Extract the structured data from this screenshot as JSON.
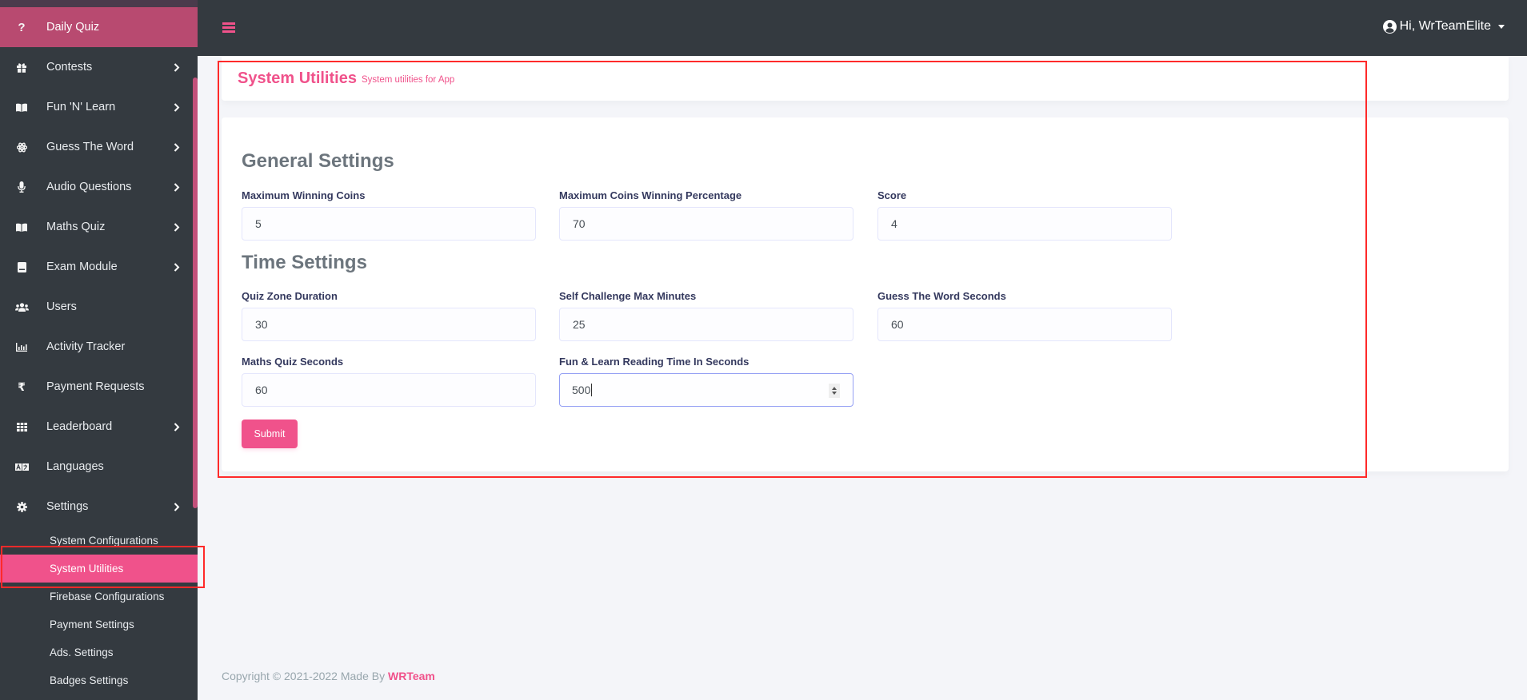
{
  "sidebar": {
    "items": [
      {
        "label": "Daily Quiz",
        "icon": "question-icon",
        "glyph": "?",
        "active": true,
        "has_children": false
      },
      {
        "label": "Contests",
        "icon": "gift-icon",
        "has_children": true
      },
      {
        "label": "Fun 'N' Learn",
        "icon": "book-open-icon",
        "has_children": true
      },
      {
        "label": "Guess The Word",
        "icon": "atom-icon",
        "has_children": true
      },
      {
        "label": "Audio Questions",
        "icon": "microphone-icon",
        "has_children": true
      },
      {
        "label": "Maths Quiz",
        "icon": "book-open-icon",
        "has_children": true
      },
      {
        "label": "Exam Module",
        "icon": "book-icon",
        "has_children": true
      },
      {
        "label": "Users",
        "icon": "users-icon",
        "has_children": false
      },
      {
        "label": "Activity Tracker",
        "icon": "chart-bar-icon",
        "has_children": false
      },
      {
        "label": "Payment Requests",
        "icon": "rupee-icon",
        "glyph": "₹",
        "has_children": false
      },
      {
        "label": "Leaderboard",
        "icon": "grid-icon",
        "has_children": true
      },
      {
        "label": "Languages",
        "icon": "language-icon",
        "has_children": false
      },
      {
        "label": "Settings",
        "icon": "gear-icon",
        "has_children": true,
        "expanded": true
      }
    ],
    "settings_children": [
      {
        "label": "System Configurations"
      },
      {
        "label": "System Utilities",
        "active": true
      },
      {
        "label": "Firebase Configurations"
      },
      {
        "label": "Payment Settings"
      },
      {
        "label": "Ads. Settings"
      },
      {
        "label": "Badges Settings"
      }
    ]
  },
  "topbar": {
    "menu_icon": "hamburger-icon",
    "user_greeting": "Hi, WrTeamElite"
  },
  "page": {
    "title": "System Utilities",
    "subtitle": "System utilities for App"
  },
  "form": {
    "general_title": "General Settings",
    "time_title": "Time Settings",
    "fields": {
      "max_winning_coins": {
        "label": "Maximum Winning Coins",
        "value": "5"
      },
      "max_coins_winning_percentage": {
        "label": "Maximum Coins Winning Percentage",
        "value": "70"
      },
      "score": {
        "label": "Score",
        "value": "4"
      },
      "quiz_zone_duration": {
        "label": "Quiz Zone Duration",
        "value": "30"
      },
      "self_challenge_max_minutes": {
        "label": "Self Challenge Max Minutes",
        "value": "25"
      },
      "guess_the_word_seconds": {
        "label": "Guess The Word Seconds",
        "value": "60"
      },
      "maths_quiz_seconds": {
        "label": "Maths Quiz Seconds",
        "value": "60"
      },
      "fun_learn_reading_time": {
        "label": "Fun & Learn Reading Time In Seconds",
        "value": "500"
      }
    },
    "submit_label": "Submit"
  },
  "footer": {
    "text": "Copyright © 2021-2022 Made By",
    "link_text": "WRTeam"
  },
  "colors": {
    "accent": "#f0528b",
    "sidebar_bg": "#343a40",
    "active_item_bg": "#b84a70",
    "page_bg": "#f4f5f9"
  }
}
